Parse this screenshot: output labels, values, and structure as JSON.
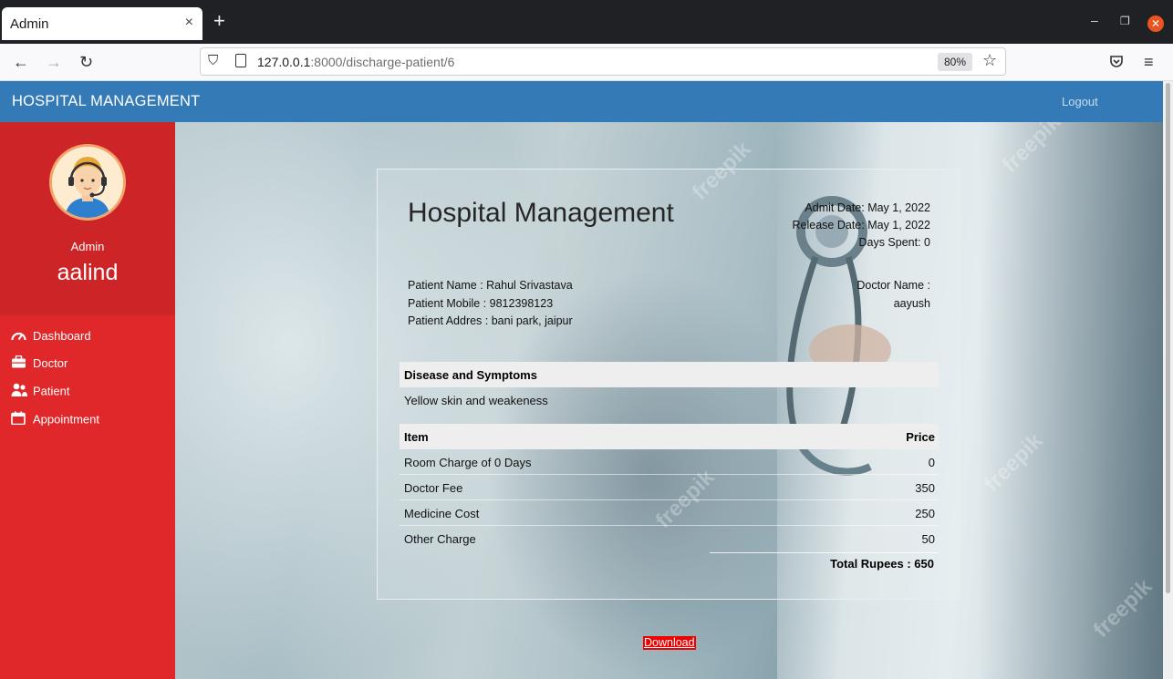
{
  "browser": {
    "tab_title": "Admin",
    "tab_close": "×",
    "new_tab": "+",
    "url_host": "127.0.0.1",
    "url_path": ":8000/discharge-patient/6",
    "zoom": "80%"
  },
  "header": {
    "title": "HOSPITAL MANAGEMENT",
    "logout": "Logout"
  },
  "sidebar": {
    "role": "Admin",
    "username": "aalind",
    "items": [
      {
        "label": "Dashboard",
        "icon": "dashboard-gauge-icon"
      },
      {
        "label": "Doctor",
        "icon": "briefcase-icon"
      },
      {
        "label": "Patient",
        "icon": "users-icon"
      },
      {
        "label": "Appointment",
        "icon": "calendar-icon"
      }
    ]
  },
  "bill": {
    "title": "Hospital Management",
    "admit_date": "Admit Date: May 1, 2022",
    "release_date": "Release Date: May 1, 2022",
    "days_spent": "Days Spent: 0",
    "patient_name": "Patient Name : Rahul Srivastava",
    "patient_mobile": "Patient Mobile : 9812398123",
    "patient_address": "Patient Addres : bani park, jaipur",
    "doctor_label": "Doctor Name :",
    "doctor_name": "aayush",
    "disease_header": "Disease and Symptoms",
    "disease_text": "Yellow skin and weakeness",
    "item_header": "Item",
    "price_header": "Price",
    "rows": [
      {
        "item": "Room Charge of 0 Days",
        "price": "0"
      },
      {
        "item": "Doctor Fee",
        "price": "350"
      },
      {
        "item": "Medicine Cost",
        "price": "250"
      },
      {
        "item": "Other Charge",
        "price": "50"
      }
    ],
    "total": "Total Rupees : 650",
    "download": "Download"
  },
  "background": {
    "watermark": "freepik"
  }
}
